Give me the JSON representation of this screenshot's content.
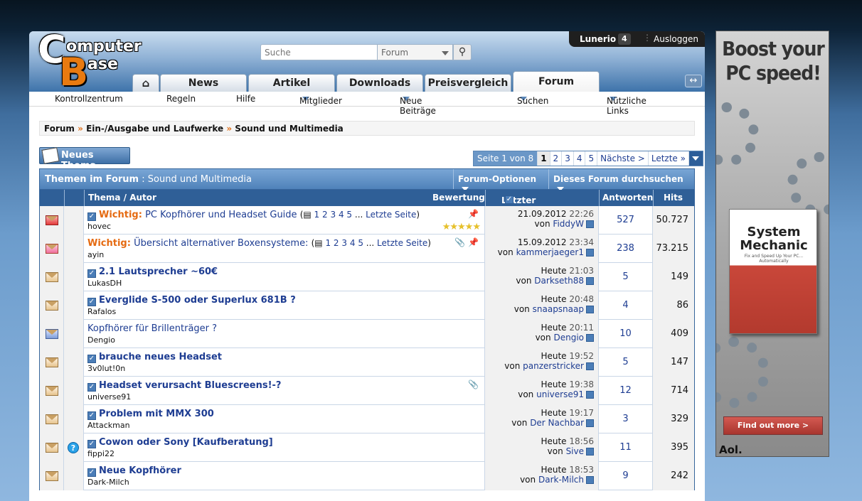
{
  "site": {
    "logo_line1": "omputer",
    "logo_line2": "ase",
    "logo_c": "C",
    "logo_b": "B"
  },
  "search": {
    "placeholder": "Suche",
    "scope": "Forum"
  },
  "user": {
    "name": "Lunerio",
    "count": "4",
    "logout": "Ausloggen"
  },
  "tabs": [
    {
      "label": "News"
    },
    {
      "label": "Artikel"
    },
    {
      "label": "Downloads"
    },
    {
      "label": "Preisvergleich"
    },
    {
      "label": "Forum",
      "active": true
    }
  ],
  "subnav": [
    "Kontrollzentrum",
    "Regeln",
    "Hilfe",
    "Mitglieder",
    "Neue Beiträge",
    "Suchen",
    "Nützliche Links"
  ],
  "breadcrumb": [
    "Forum",
    "Ein-/Ausgabe und Laufwerke",
    "Sound und Multimedia"
  ],
  "new_thread": "Neues Thema",
  "pager": {
    "label": "Seite 1 von 8",
    "pages": [
      "1",
      "2",
      "3",
      "4",
      "5"
    ],
    "next": "Nächste >",
    "last": "Letzte »"
  },
  "forum_bar": {
    "prefix": "Themen im Forum",
    "sep": " : ",
    "name": "Sound und Multimedia",
    "options": "Forum-Optionen",
    "search": "Dieses Forum durchsuchen"
  },
  "columns": {
    "thread": "Thema / Autor",
    "rating": "Bewertung",
    "last": "Letzter Beitrag",
    "replies": "Antworten",
    "hits": "Hits"
  },
  "threads": [
    {
      "prefix": "Wichtig:",
      "title": "PC Kopfhörer und Headset Guide",
      "pages": [
        "1",
        "2",
        "3",
        "4",
        "5"
      ],
      "last_page": "Letzte Seite",
      "author": "hovec",
      "date": "21.09.2012",
      "time": "22:26",
      "by_label": "von",
      "by": "FiddyW",
      "replies": "527",
      "hits": "50.727",
      "stars": "★★★★★",
      "icon": "hot",
      "bold": false,
      "checkbox": true
    },
    {
      "prefix": "Wichtig:",
      "title": "Übersicht alternativer Boxensysteme:",
      "pages": [
        "1",
        "2",
        "3",
        "4",
        "5"
      ],
      "last_page": "Letzte Seite",
      "author": "ayin",
      "date": "15.09.2012",
      "time": "23:34",
      "by_label": "von",
      "by": "kammerjaeger1",
      "replies": "238",
      "hits": "73.215",
      "icon": "pink",
      "bold": false,
      "checkbox": false,
      "clip": true
    },
    {
      "title": "2.1 Lautsprecher ~60€",
      "author": "LukasDH",
      "date": "Heute",
      "time": "21:03",
      "by_label": "von",
      "by": "Darkseth88",
      "replies": "5",
      "hits": "149",
      "icon": "normal",
      "bold": true,
      "checkbox": true
    },
    {
      "title": "Everglide S-500 oder Superlux 681B ?",
      "author": "Rafalos",
      "date": "Heute",
      "time": "20:48",
      "by_label": "von",
      "by": "snaapsnaap",
      "replies": "4",
      "hits": "86",
      "icon": "normal",
      "bold": true,
      "checkbox": true
    },
    {
      "title": "Kopfhörer für Brillenträger ?",
      "author": "Dengio",
      "date": "Heute",
      "time": "20:11",
      "by_label": "von",
      "by": "Dengio",
      "replies": "10",
      "hits": "409",
      "icon": "blue",
      "bold": false,
      "checkbox": false
    },
    {
      "title": "brauche neues Headset",
      "author": "3v0lut!0n",
      "date": "Heute",
      "time": "19:52",
      "by_label": "von",
      "by": "panzerstricker",
      "replies": "5",
      "hits": "147",
      "icon": "normal",
      "bold": true,
      "checkbox": true
    },
    {
      "title": "Headset verursacht Bluescreens!-?",
      "author": "universe91",
      "date": "Heute",
      "time": "19:38",
      "by_label": "von",
      "by": "universe91",
      "replies": "12",
      "hits": "714",
      "icon": "normal",
      "bold": true,
      "checkbox": true,
      "clip": true
    },
    {
      "title": "Problem mit MMX 300",
      "author": "Attackman",
      "date": "Heute",
      "time": "19:17",
      "by_label": "von",
      "by": "Der Nachbar",
      "replies": "3",
      "hits": "329",
      "icon": "normal",
      "bold": true,
      "checkbox": true
    },
    {
      "title": "Cowon oder Sony [Kaufberatung]",
      "author": "fippi22",
      "date": "Heute",
      "time": "18:56",
      "by_label": "von",
      "by": "Sive",
      "replies": "11",
      "hits": "395",
      "icon": "normal",
      "bold": true,
      "checkbox": true,
      "question": true
    },
    {
      "title": "Neue Kopfhörer",
      "author": "Dark-Milch",
      "date": "Heute",
      "time": "18:53",
      "by_label": "von",
      "by": "Dark-Milch",
      "replies": "9",
      "hits": "242",
      "icon": "normal",
      "bold": true,
      "checkbox": true
    }
  ],
  "ad": {
    "headline": "Boost your PC speed!",
    "product": "System Mechanic",
    "tagline": "Fix and Speed Up Your PC... Automatically",
    "cta": "Find out more >",
    "brand": "Aol."
  }
}
